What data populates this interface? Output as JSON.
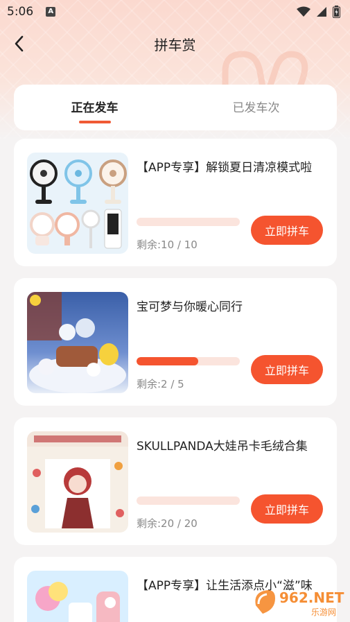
{
  "status": {
    "time": "5:06",
    "badge": "A"
  },
  "nav": {
    "title": "拼车赏"
  },
  "tabs": [
    {
      "label": "正在发车",
      "active": true
    },
    {
      "label": "已发车次",
      "active": false
    }
  ],
  "items": [
    {
      "title": "【APP专享】解锁夏日清凉模式啦",
      "remain_label": "剩余:10 / 10",
      "remaining": 10,
      "total": 10,
      "button": "立即拼车",
      "image": "fans-product-image"
    },
    {
      "title": "宝可梦与你暖心同行",
      "remain_label": "剩余:2 / 5",
      "remaining": 2,
      "total": 5,
      "button": "立即拼车",
      "image": "pokemon-figures-image"
    },
    {
      "title": "SKULLPANDA大娃吊卡毛绒合集",
      "remain_label": "剩余:20 / 20",
      "remaining": 20,
      "total": 20,
      "button": "立即拼车",
      "image": "skullpanda-poster-image"
    },
    {
      "title": "【APP专享】让生活添点小“滋”味",
      "image": "drinks-product-image"
    }
  ],
  "watermark": {
    "text": "962.NET",
    "sub": "乐游网"
  },
  "colors": {
    "accent": "#f5542f",
    "progress_track": "#fbe4dd",
    "header_bg": "#fbd9cf"
  }
}
